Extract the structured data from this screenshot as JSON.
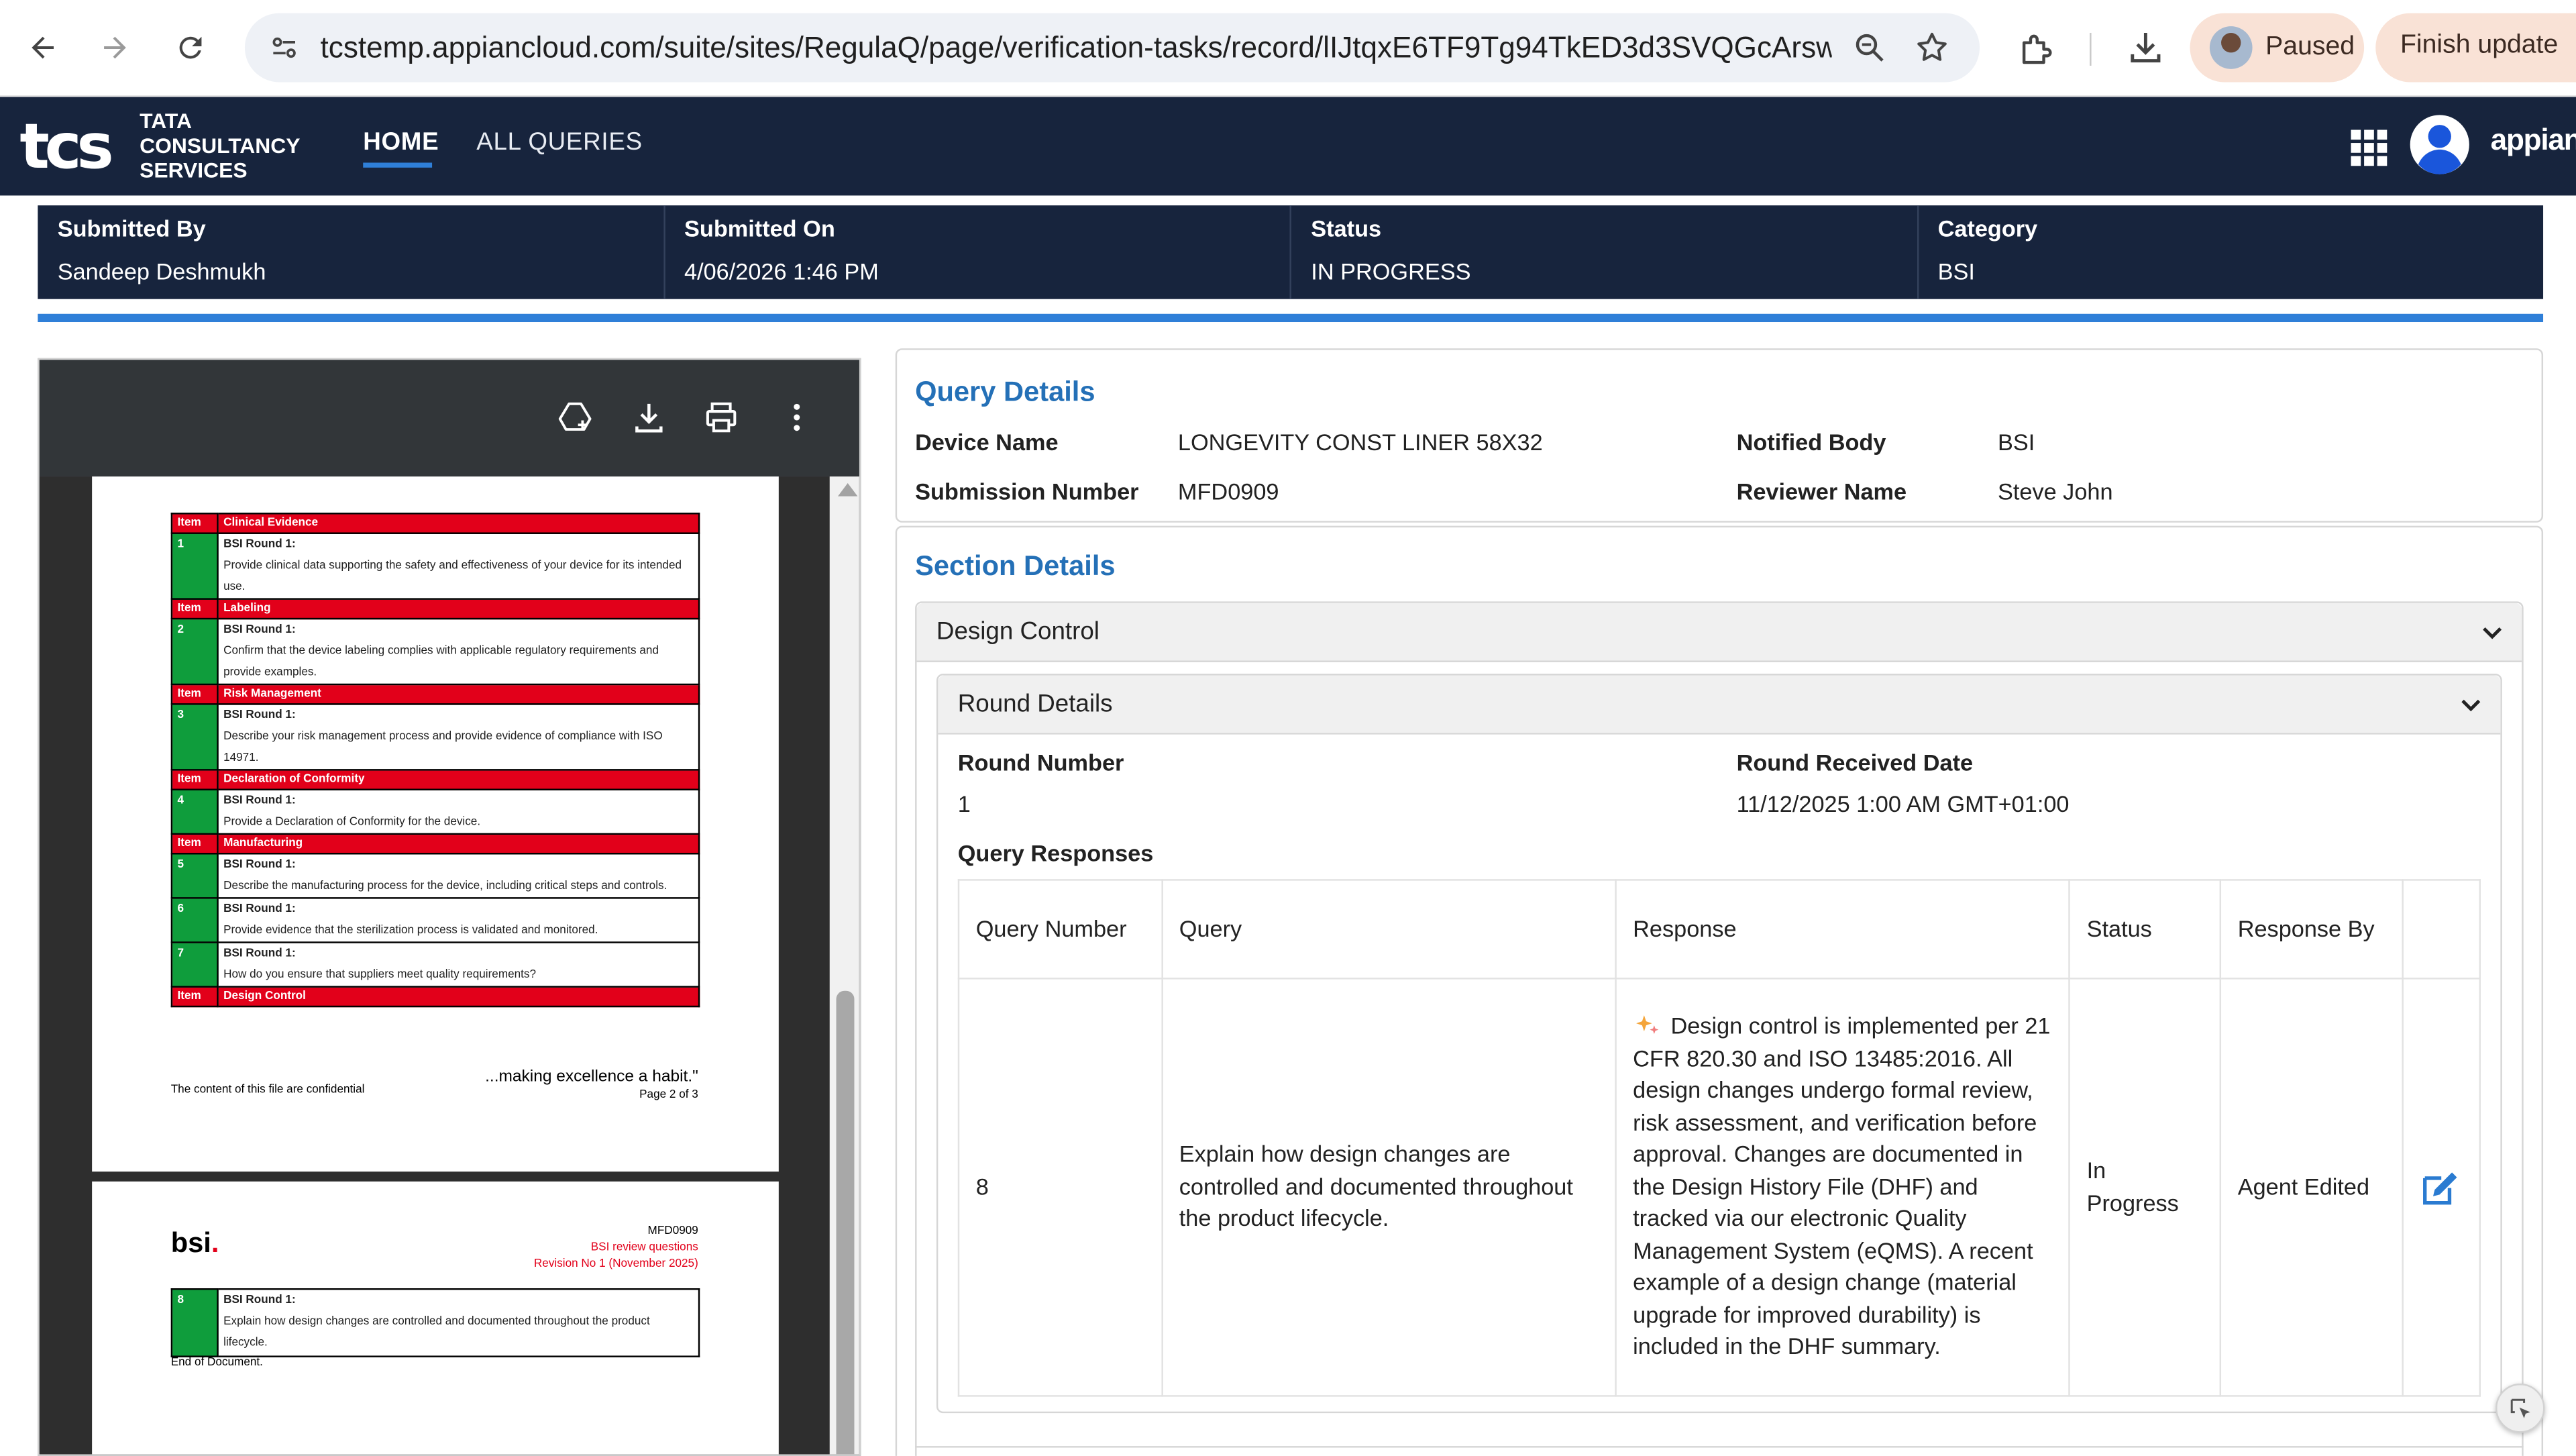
{
  "browser": {
    "url": "tcstemp.appiancloud.com/suite/sites/RegulaQ/page/verification-tasks/record/lIJtqxE6TF9Tg94TkED3d3SVQGcArswEM...",
    "paused_label": "Paused",
    "finish_label": "Finish update"
  },
  "app": {
    "logo_mark": "tcs",
    "logo_line1": "TATA",
    "logo_line2": "CONSULTANCY",
    "logo_line3": "SERVICES",
    "tabs": [
      {
        "label": "HOME"
      },
      {
        "label": "ALL QUERIES"
      }
    ],
    "appian_label": "appian"
  },
  "summary": [
    {
      "label": "Submitted By",
      "value": "Sandeep Deshmukh"
    },
    {
      "label": "Submitted On",
      "value": "4/06/2026 1:46 PM"
    },
    {
      "label": "Status",
      "value": "IN PROGRESS"
    },
    {
      "label": "Category",
      "value": "BSI"
    }
  ],
  "pdf": {
    "page1_rows": [
      {
        "head": "Clinical Evidence",
        "num": "1",
        "round": "BSI Round 1:",
        "text": "Provide clinical data supporting the safety and effectiveness of your device for its intended use."
      },
      {
        "head": "Labeling",
        "num": "2",
        "round": "BSI Round 1:",
        "text": "Confirm that the device labeling complies with applicable regulatory requirements and provide examples."
      },
      {
        "head": "Risk Management",
        "num": "3",
        "round": "BSI Round 1:",
        "text": "Describe your risk management process and provide evidence of compliance with ISO 14971."
      },
      {
        "head": "Declaration of Conformity",
        "num": "4",
        "round": "BSI Round 1:",
        "text": "Provide a Declaration of Conformity for the device."
      },
      {
        "head": "Manufacturing",
        "num": "5",
        "round": "BSI Round 1:",
        "text": "Describe the manufacturing process for the device, including critical steps and controls."
      },
      {
        "head": "",
        "num": "6",
        "round": "BSI Round 1:",
        "text": "Provide evidence that the sterilization process is validated and monitored."
      },
      {
        "head": "",
        "num": "7",
        "round": "BSI Round 1:",
        "text": "How do you ensure that suppliers meet quality requirements?"
      },
      {
        "head": "Design Control",
        "num": "",
        "round": "",
        "text": ""
      }
    ],
    "item_label": "Item",
    "confidential": "The content of this file are confidential",
    "tagline": "...making excellence a habit.\"",
    "page_label": "Page 2 of 3",
    "bsi_logo": "bsi",
    "page2_ref": "MFD0909",
    "page2_subtitle": "BSI review questions",
    "page2_revision": "Revision No 1 (November 2025)",
    "page2_row": {
      "num": "8",
      "round": "BSI Round 1:",
      "text": "Explain how design changes are controlled and documented throughout the product lifecycle."
    },
    "end_doc": "End of Document."
  },
  "query_details": {
    "title": "Query Details",
    "device_name_label": "Device Name",
    "device_name": "LONGEVITY CONST LINER 58X32",
    "submission_label": "Submission Number",
    "submission_number": "MFD0909",
    "notified_body_label": "Notified Body",
    "notified_body": "BSI",
    "reviewer_label": "Reviewer Name",
    "reviewer_name": "Steve John"
  },
  "section_details": {
    "title": "Section Details",
    "section_name": "Design Control",
    "round_details_title": "Round Details",
    "round_number_label": "Round Number",
    "round_number": "1",
    "round_date_label": "Round Received Date",
    "round_date": "11/12/2025 1:00 AM GMT+01:00",
    "query_responses_label": "Query Responses",
    "columns": [
      "Query Number",
      "Query",
      "Response",
      "Status",
      "Response By"
    ],
    "row": {
      "query_number": "8",
      "query": "Explain how design changes are controlled and documented throughout the product lifecycle.",
      "response": "Design control is implemented per 21 CFR 820.30 and ISO 13485:2016. All design changes undergo formal review, risk assessment, and verification before approval. Changes are documented in the Design History File (DHF) and tracked via our electronic Quality Management System (eQMS). A recent example of a design change (material upgrade for improved durability) is included in the DHF summary.",
      "status": "In Progress",
      "response_by": "Agent Edited"
    }
  },
  "colors": {
    "header_bg": "#17243d",
    "accent_blue": "#2f7fd8",
    "section_title": "#2470b7",
    "pdf_red": "#e2001a",
    "pdf_green": "#0f9d3c"
  }
}
